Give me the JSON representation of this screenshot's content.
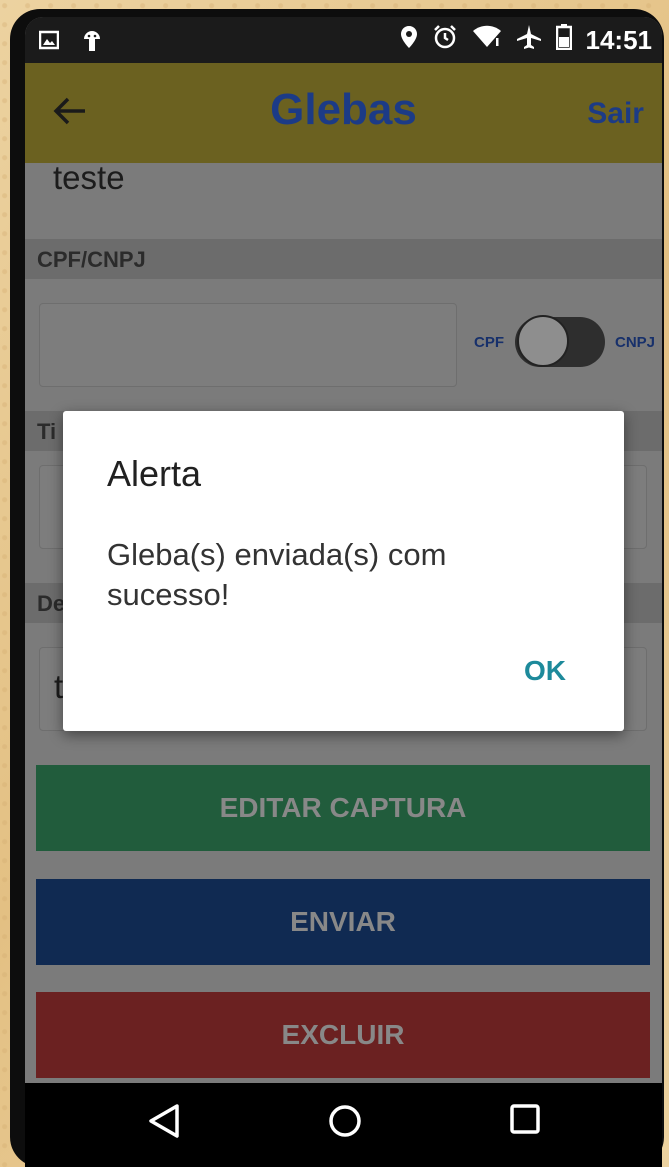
{
  "status_bar": {
    "time": "14:51",
    "icons_left": [
      "image-icon",
      "android-icon"
    ],
    "icons_right": [
      "location-icon",
      "alarm-icon",
      "wifi-icon",
      "airplane-icon",
      "battery-icon"
    ]
  },
  "app_bar": {
    "back_icon": "back-arrow-icon",
    "title": "Glebas",
    "logout_label": "Sair"
  },
  "form": {
    "name_value": "teste",
    "cpf_cnpj_label": "CPF/CNPJ",
    "cpf_cnpj_value": "",
    "toggle_left_label": "CPF",
    "toggle_right_label": "CNPJ",
    "toggle_state": "off",
    "section_two_label_partial": "Ti",
    "section_three_label_partial": "De",
    "field_three_partial": "t"
  },
  "actions": {
    "edit_label": "EDITAR CAPTURA",
    "send_label": "ENVIAR",
    "delete_label": "EXCLUIR"
  },
  "dialog": {
    "title": "Alerta",
    "message": "Gleba(s) enviada(s) com sucesso!",
    "ok_label": "OK"
  },
  "nav": {
    "back": "nav-back-icon",
    "home": "nav-home-icon",
    "recents": "nav-recents-icon"
  },
  "colors": {
    "app_bar": "#6b6120",
    "title": "#1c3b86",
    "edit_button": "#215c3c",
    "send_button": "#102a52",
    "delete_button": "#6b2121",
    "dialog_ok": "#1d8a9b"
  }
}
